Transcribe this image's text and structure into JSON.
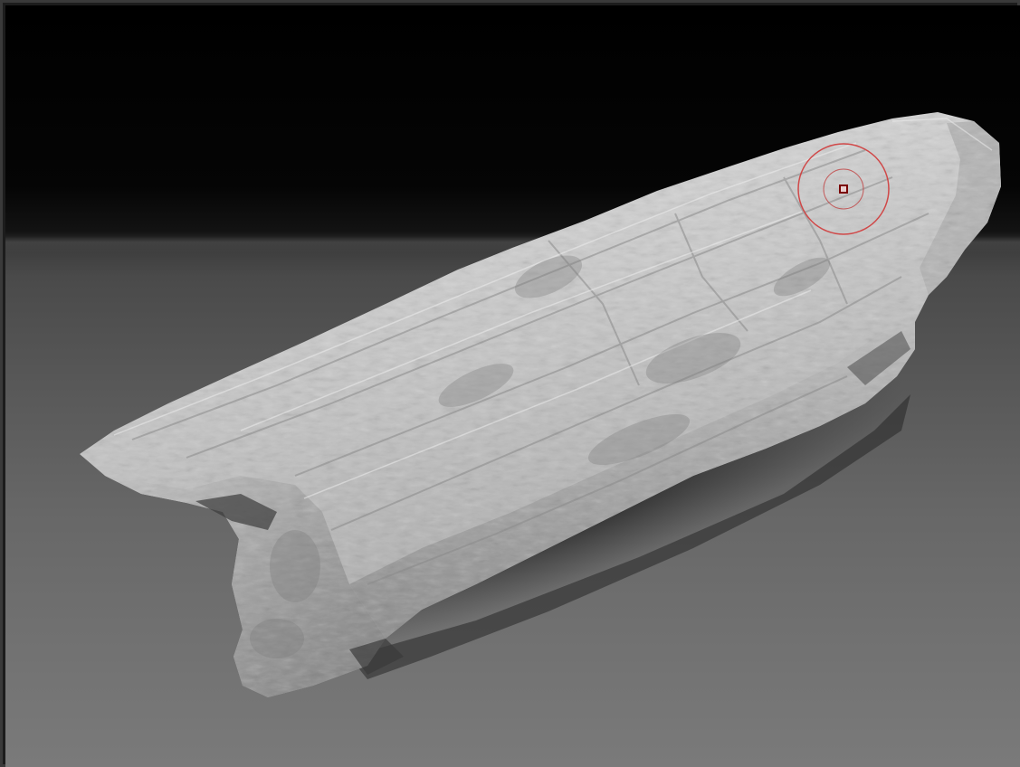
{
  "canvas": {
    "background_top": "#000000",
    "floor_color": "#6e6e6e",
    "frame_color": "#3a3a3a"
  },
  "model": {
    "material_light": "#d8d8d8",
    "material_mid": "#a9a9a9",
    "material_dark": "#5a5a5a"
  },
  "brush": {
    "outer_ring_color": "#d03a3a",
    "inner_ring_color": "#c04040",
    "center_dot_color": "#7a0000"
  }
}
